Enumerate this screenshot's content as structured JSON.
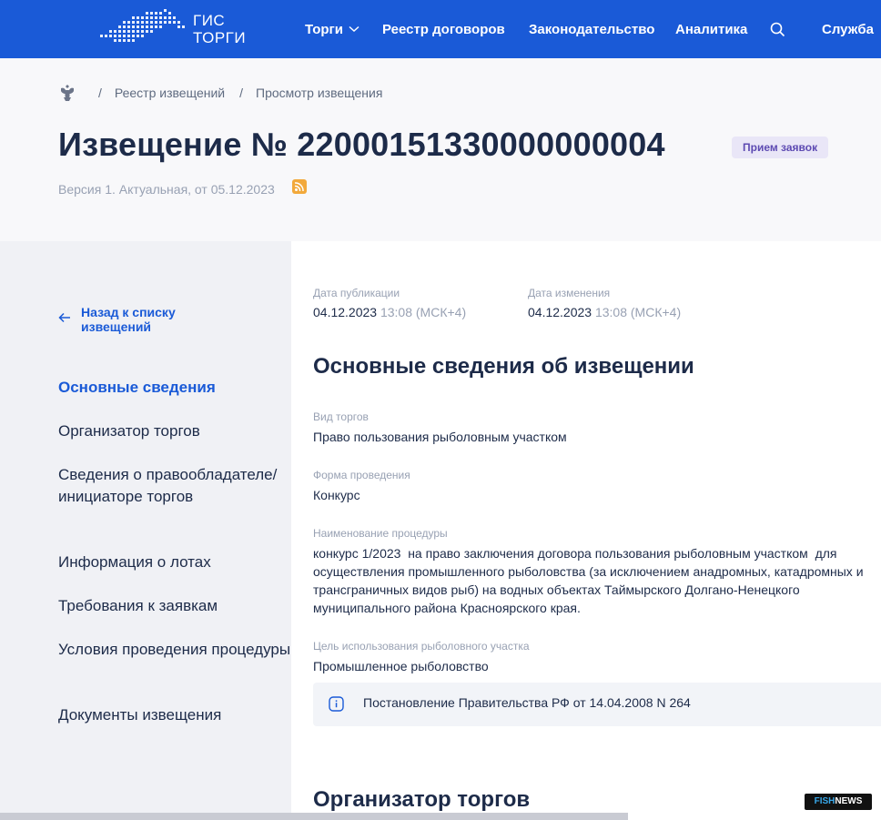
{
  "header": {
    "logo_line1": "ГИС",
    "logo_line2": "ТОРГИ",
    "nav": {
      "torgi": "Торги",
      "reestr_dogovorov": "Реестр договоров",
      "zakonodatelstvo": "Законодательство",
      "analitika": "Аналитика",
      "sluzhba": "Служба"
    }
  },
  "breadcrumb": {
    "item1": "Реестр извещений",
    "item2": "Просмотр извещения",
    "separator": "/"
  },
  "notice": {
    "title": "Извещение № 22000151330000000004",
    "status": "Прием заявок",
    "version": "Версия 1. Актуальная, от 05.12.2023"
  },
  "sidebar": {
    "back_label": "Назад к списку извещений",
    "items": [
      "Основные сведения",
      "Организатор торгов",
      "Сведения о правообладателе/инициаторе торгов",
      "Информация о лотах",
      "Требования к заявкам",
      "Условия проведения процедуры",
      "Документы извещения"
    ]
  },
  "meta": {
    "published_label": "Дата публикации",
    "published_date": "04.12.2023",
    "published_time": "13:08 (МСК+4)",
    "changed_label": "Дата изменения",
    "changed_date": "04.12.2023",
    "changed_time": "13:08 (МСК+4)"
  },
  "main_info": {
    "title": "Основные сведения об извещении",
    "fields": [
      {
        "label": "Вид торгов",
        "value": "Право пользования рыболовным участком"
      },
      {
        "label": "Форма проведения",
        "value": "Конкурс"
      },
      {
        "label": "Наименование процедуры",
        "value": "конкурс 1/2023  на право заключения договора пользования рыболовным участком  для осуществления промышленного рыболовства (за исключением анадромных, катадромных и трансграничных видов рыб) на водных объектах Таймырского Долгано-Ненецкого муниципального района Красноярского края."
      },
      {
        "label": "Цель использования рыболовного участка",
        "value": "Промышленное рыболовство"
      }
    ],
    "info_note": "Постановление Правительства РФ от 14.04.2008 N 264"
  },
  "organizer": {
    "title": "Организатор торгов"
  },
  "watermark": {
    "part1": "FISH",
    "part2": "NEWS"
  },
  "colors": {
    "brand_blue": "#1a5ad7",
    "status_bg": "#e9e6f7",
    "status_text": "#5d4ab2",
    "rss": "#f2a93b"
  }
}
